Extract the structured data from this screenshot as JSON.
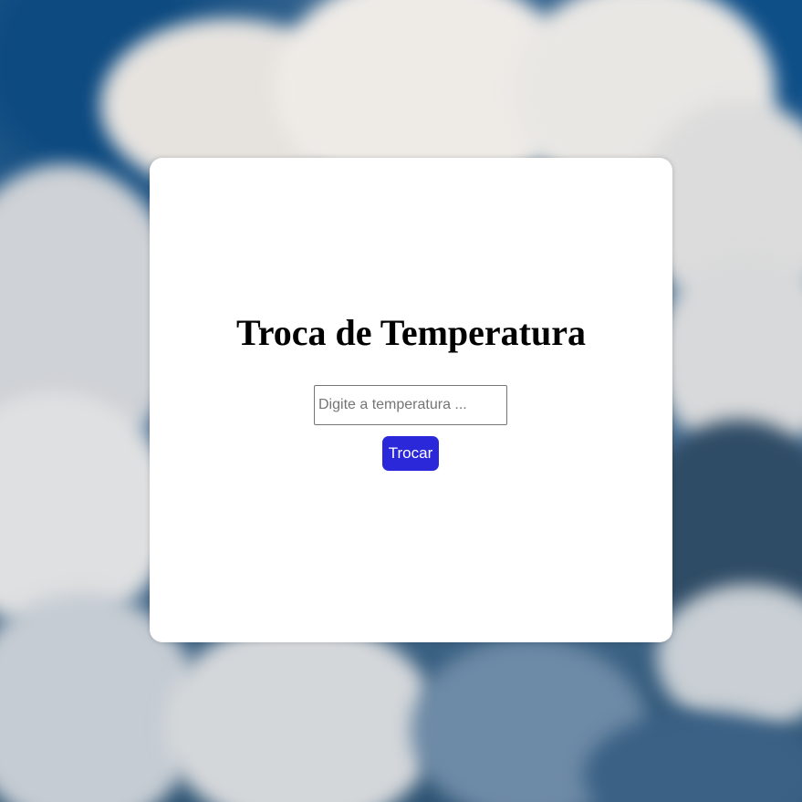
{
  "page": {
    "title": "Troca de Temperatura"
  },
  "form": {
    "temperature_input": {
      "value": "",
      "placeholder": "Digite a temperatura ..."
    },
    "swap_label": "Trocar"
  },
  "colors": {
    "button": "#2a28d9",
    "card": "#ffffff",
    "sky": "#2b5c8a"
  }
}
